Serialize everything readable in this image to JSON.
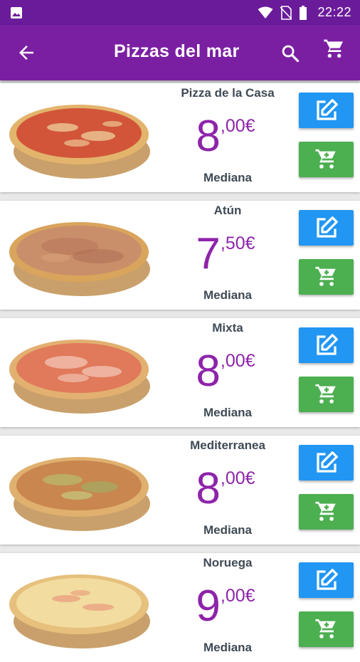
{
  "status_bar": {
    "time": "22:22"
  },
  "app_bar": {
    "title": "Pizzas del mar"
  },
  "colors": {
    "status": "#6a1b9a",
    "appbar": "#7b1fa2",
    "price": "#8e24aa",
    "edit": "#2196f3",
    "add": "#4caf50"
  },
  "icons": {
    "back": "arrow-back-icon",
    "search": "search-icon",
    "cart": "shopping-cart-icon",
    "edit": "edit-icon",
    "add": "add-to-cart-icon"
  },
  "items": [
    {
      "name": "Pizza de la Casa",
      "price_int": "8",
      "price_dec": ",00€",
      "size": "Mediana",
      "topping": "tomato"
    },
    {
      "name": "Atún",
      "price_int": "7",
      "price_dec": ",50€",
      "size": "Mediana",
      "topping": "tuna"
    },
    {
      "name": "Mixta",
      "price_int": "8",
      "price_dec": ",00€",
      "size": "Mediana",
      "topping": "ham"
    },
    {
      "name": "Mediterranea",
      "price_int": "8",
      "price_dec": ",00€",
      "size": "Mediana",
      "topping": "veg"
    },
    {
      "name": "Noruega",
      "price_int": "9",
      "price_dec": ",00€",
      "size": "Mediana",
      "topping": "salmon"
    }
  ]
}
